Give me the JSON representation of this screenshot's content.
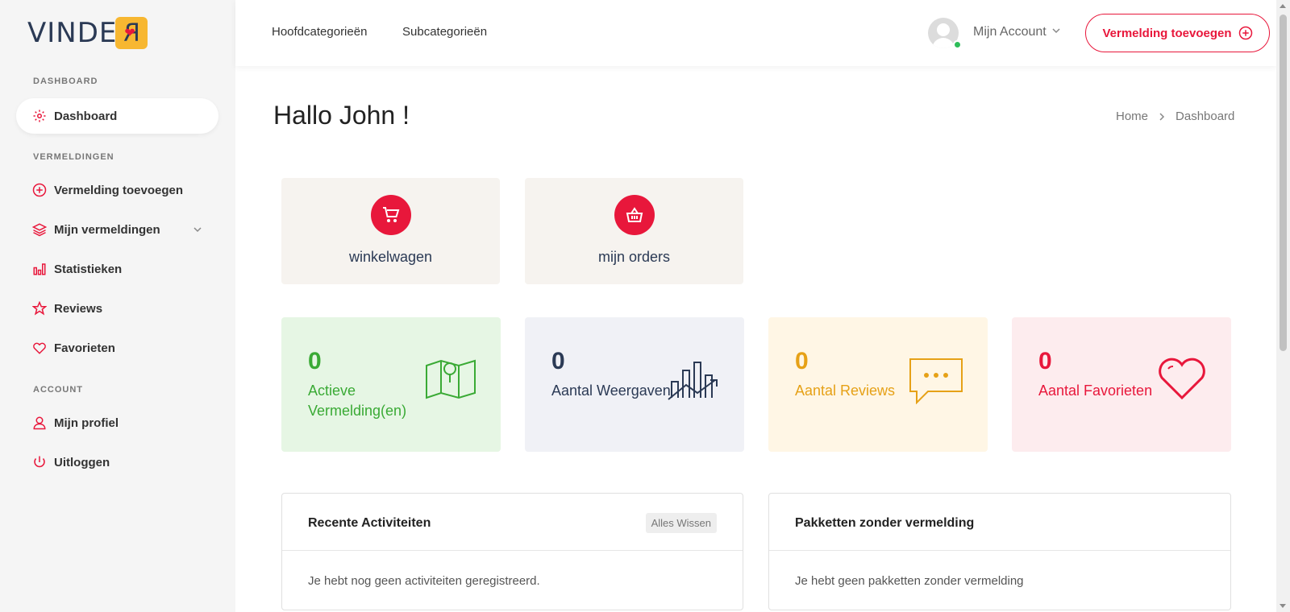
{
  "brand": {
    "logo_text": "VINDE",
    "logo_badge_char": "R"
  },
  "sidebar": {
    "sections": [
      {
        "title": "DASHBOARD"
      },
      {
        "title": "VERMELDINGEN"
      },
      {
        "title": "ACCOUNT"
      }
    ],
    "items": [
      {
        "label": "Dashboard",
        "icon": "gear-icon",
        "active": true
      },
      {
        "label": "Vermelding toevoegen",
        "icon": "plus-circle-icon"
      },
      {
        "label": "Mijn vermeldingen",
        "icon": "layers-icon",
        "has_submenu": true
      },
      {
        "label": "Statistieken",
        "icon": "bar-chart-icon"
      },
      {
        "label": "Reviews",
        "icon": "star-icon"
      },
      {
        "label": "Favorieten",
        "icon": "heart-icon"
      },
      {
        "label": "Mijn profiel",
        "icon": "user-icon"
      },
      {
        "label": "Uitloggen",
        "icon": "power-icon"
      }
    ]
  },
  "header": {
    "links": [
      "Hoofdcategorieën",
      "Subcategorieën"
    ],
    "account_label": "Mijn Account",
    "add_button": "Vermelding toevoegen"
  },
  "main": {
    "greeting": "Hallo John !",
    "breadcrumb": [
      "Home",
      "Dashboard"
    ],
    "tiles": [
      {
        "label": "winkelwagen",
        "icon": "cart-icon"
      },
      {
        "label": "mijn orders",
        "icon": "basket-icon"
      }
    ],
    "stats": [
      {
        "value": "0",
        "label": "Actieve Vermelding(en)",
        "icon": "map-pin-icon",
        "color": "#3aaa35",
        "bg": "#e6f6e4"
      },
      {
        "value": "0",
        "label": "Aantal Weergaven",
        "icon": "chart-trend-icon",
        "color": "#2b3a55",
        "bg": "#f0f1f6"
      },
      {
        "value": "0",
        "label": "Aantal Reviews",
        "icon": "chat-bubble-icon",
        "color": "#e6a117",
        "bg": "#fff6e5"
      },
      {
        "value": "0",
        "label": "Aantal Favorieten",
        "icon": "heart-outline-icon",
        "color": "#e8173b",
        "bg": "#fdecee"
      }
    ],
    "panels": [
      {
        "title": "Recente Activiteiten",
        "button": "Alles Wissen",
        "text": "Je hebt nog geen activiteiten geregistreerd."
      },
      {
        "title": "Pakketten zonder vermelding",
        "text": "Je hebt geen pakketten zonder vermelding"
      }
    ]
  },
  "colors": {
    "accent": "#e8173b",
    "sidebar_bg": "#f5f5f5",
    "brand_dark": "#2b3a55",
    "online": "#2ebd59"
  }
}
